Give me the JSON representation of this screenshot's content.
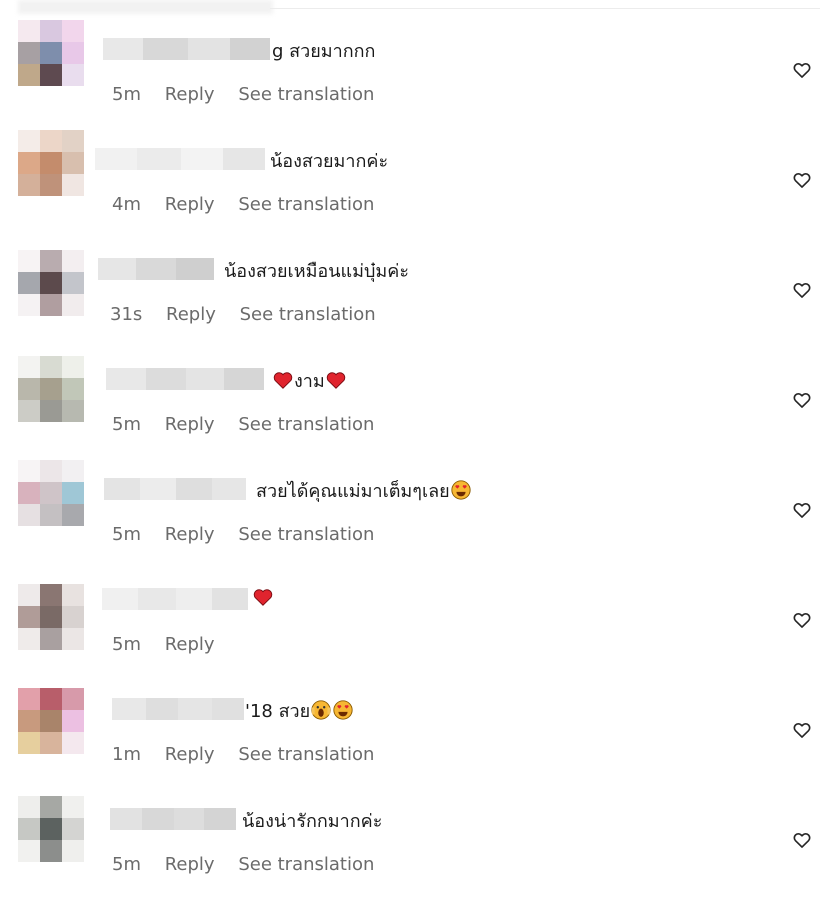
{
  "labels": {
    "reply": "Reply",
    "see_translation": "See translation"
  },
  "comments": [
    {
      "text": "g สวยมากกก",
      "time": "5m",
      "has_translation": true,
      "emojis": []
    },
    {
      "text": "น้องสวยมากค่ะ",
      "time": "4m",
      "has_translation": true,
      "emojis": []
    },
    {
      "text": "น้องสวยเหมือนแม่บุ๋มค่ะ",
      "time": "31s",
      "has_translation": true,
      "emojis": []
    },
    {
      "text": "งาม",
      "time": "5m",
      "has_translation": true,
      "emojis": [
        "red-heart",
        "red-heart"
      ]
    },
    {
      "text": "สวยได้คุณแม่มาเต็มๆเลย",
      "time": "5m",
      "has_translation": true,
      "emojis": [
        "heart-eyes"
      ]
    },
    {
      "text": "",
      "time": "5m",
      "has_translation": false,
      "emojis": [
        "red-heart"
      ]
    },
    {
      "text": "'18 สวย",
      "time": "1m",
      "has_translation": true,
      "emojis": [
        "screaming-face",
        "heart-eyes"
      ]
    },
    {
      "text": "น้องน่ารักกมากค่ะ",
      "time": "5m",
      "has_translation": true,
      "emojis": []
    }
  ],
  "icons": {
    "like": "heart-outline-icon"
  },
  "colors": {
    "meta": "#6b6b6b",
    "heart": "#e0242e"
  }
}
